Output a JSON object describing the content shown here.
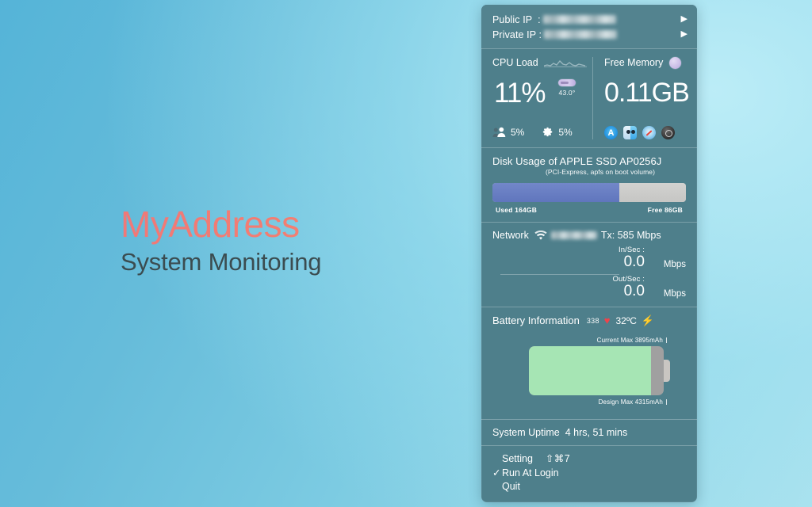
{
  "brand": {
    "name": "MyAddress",
    "tagline": "System Monitoring",
    "accent_color": "#f07d78",
    "tagline_color": "#3b4c50"
  },
  "panel": {
    "background_color": "#4e7f8b",
    "ip": {
      "public_label": "Public IP  :",
      "public_value_redacted": true,
      "private_label": "Private IP :",
      "private_value_redacted": true,
      "arrow_icon": "▶"
    },
    "cpu": {
      "title": "CPU Load",
      "load_percent": "11%",
      "temperature": "43.0°",
      "user_percent": "5%",
      "system_percent": "5%",
      "sparkline": [
        2,
        3,
        2,
        4,
        3,
        6,
        4,
        3,
        5,
        3,
        2,
        4,
        3,
        2,
        3,
        2
      ]
    },
    "memory": {
      "title": "Free Memory",
      "free": "0.11GB",
      "apps": [
        "app-store",
        "finder",
        "safari",
        "preview"
      ]
    },
    "disk": {
      "title": "Disk Usage of APPLE SSD AP0256J",
      "subtitle": "(PCI-Express, apfs on boot volume)",
      "used_label": "Used 164GB",
      "free_label": "Free 86GB",
      "used_gb": 164,
      "free_gb": 86,
      "used_percent": 65.6,
      "used_color": "#6679c2",
      "free_color": "#cccccb"
    },
    "network": {
      "title": "Network",
      "ssid_redacted": true,
      "tx": "Tx: 585 Mbps",
      "in_label": "In/Sec :",
      "in_value": "0.0",
      "in_unit": "Mbps",
      "out_label": "Out/Sec :",
      "out_value": "0.0",
      "out_unit": "Mbps"
    },
    "battery": {
      "title": "Battery Information",
      "cycles": "338",
      "health_icon": "♥",
      "temperature": "32ºC",
      "charging_icon": "⚡",
      "current_max_label": "Current Max 3895mAh",
      "design_max_label": "Design Max 4315mAh",
      "current_max_mah": 3895,
      "design_max_mah": 4315,
      "health_percent": 90.3,
      "fill_color": "#a6e5b4"
    },
    "uptime": {
      "label": "System Uptime",
      "value": "4 hrs, 51 mins"
    },
    "menu": {
      "setting_label": "Setting",
      "setting_shortcut": "⇧⌘7",
      "run_at_login_label": "Run At Login",
      "run_at_login_checked": true,
      "check_glyph": "✓",
      "quit_label": "Quit"
    }
  }
}
